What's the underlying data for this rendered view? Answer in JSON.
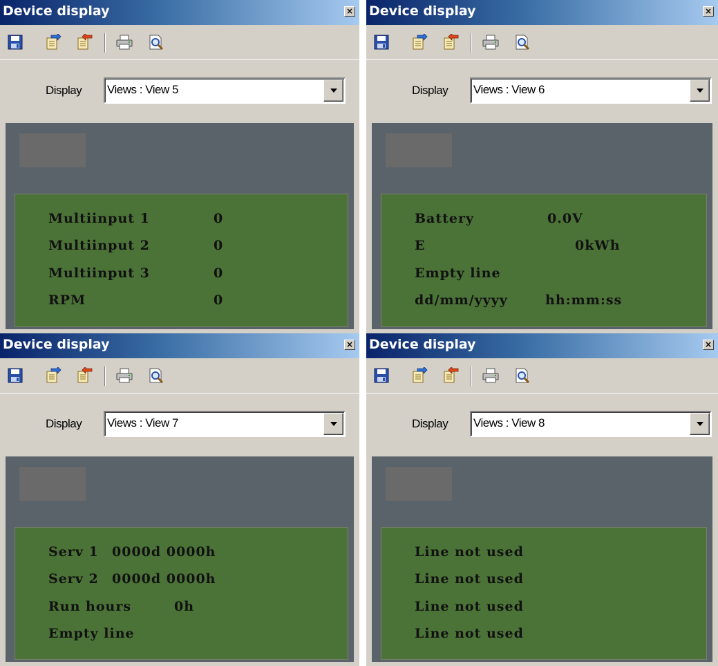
{
  "colors": {
    "title_gradient_start": "#0a246a",
    "title_gradient_end": "#a6caf0",
    "window_face": "#d4d0c8",
    "screen_bg": "#5a636a",
    "lcd_bg": "#4b7337",
    "lcd_text": "#111111"
  },
  "panels": [
    {
      "title": "Device display",
      "close_glyph": "×",
      "display_label": "Display",
      "display_value": "Views : View 5",
      "lines": [
        "Multiinput 1",
        "Multiinput 2",
        "Multiinput 3",
        "RPM"
      ],
      "values": [
        "0",
        "0",
        "0",
        "0"
      ]
    },
    {
      "title": "Device display",
      "close_glyph": "×",
      "display_label": "Display",
      "display_value": "Views : View 6",
      "lines": [
        "Battery",
        "E",
        "Empty line",
        "dd/mm/yyyy"
      ],
      "values": [
        "0.0V",
        "0kWh",
        "",
        "hh:mm:ss"
      ]
    },
    {
      "title": "Device display",
      "close_glyph": "×",
      "display_label": "Display",
      "display_value": "Views : View 7",
      "lines": [
        "Serv 1",
        "Serv 2",
        "Run hours",
        "Empty line"
      ],
      "values": [
        "0000d 0000h",
        "0000d 0000h",
        "0h",
        ""
      ]
    },
    {
      "title": "Device display",
      "close_glyph": "×",
      "display_label": "Display",
      "display_value": "Views : View 8",
      "lines": [
        "Line not used",
        "Line not used",
        "Line not used",
        "Line not used"
      ],
      "values": [
        "",
        "",
        "",
        ""
      ]
    }
  ],
  "toolbar_icons": [
    "save-icon",
    "import-icon",
    "export-icon",
    "print-icon",
    "print-preview-icon"
  ]
}
